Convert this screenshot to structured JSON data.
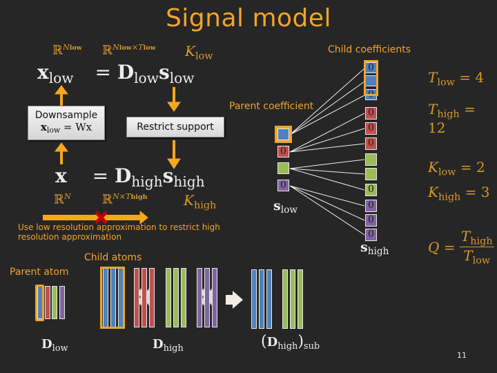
{
  "title": "Signal model",
  "equation_low": {
    "lhs": "x",
    "lhs_sub": "low",
    "eq": "=",
    "dict": "D",
    "dict_sub": "low",
    "coef": "s",
    "coef_sub": "low",
    "dim_x": "ℝ",
    "dim_x_sup": "N",
    "dim_x_sup_sub": "low",
    "dim_d": "ℝ",
    "dim_d_sup": "N",
    "dim_d_sup_sub1": "low",
    "dim_d_sup_times": "×T",
    "dim_d_sup_sub2": "low",
    "sparsity": "K",
    "sparsity_sub": "low"
  },
  "equation_high": {
    "lhs": "x",
    "eq": "=",
    "dict": "D",
    "dict_sub": "high",
    "coef": "s",
    "coef_sub": "high",
    "dim_x": "ℝ",
    "dim_x_sup": "N",
    "dim_d": "ℝ",
    "dim_d_sup": "N×T",
    "dim_d_sup_sub": "high",
    "sparsity": "K",
    "sparsity_sub": "high"
  },
  "downsample_box": {
    "line1": "Downsample",
    "lhs": "x",
    "lhs_sub": "low",
    "rhs": "= Wx"
  },
  "restrict_box": {
    "label": "Restrict support"
  },
  "labels": {
    "child_coefficients": "Child coefficients",
    "parent_coefficient": "Parent coefficient",
    "s_low": "s",
    "s_low_sub": "low",
    "s_high": "s",
    "s_high_sub": "high",
    "note": "Use low resolution approximation to restrict high resolution approximation",
    "child_atoms": "Child atoms",
    "parent_atom": "Parent atom",
    "d_low": "D",
    "d_low_sub": "low",
    "d_high": "D",
    "d_high_sub": "high",
    "d_high_sub_open": "(",
    "d_high_sub_close": ")",
    "d_high_sub_label": "sub"
  },
  "params": {
    "t_low": {
      "sym": "T",
      "sub": "low",
      "val": "= 4"
    },
    "t_high": {
      "sym": "T",
      "sub": "high",
      "val": "= 12"
    },
    "k_low": {
      "sym": "K",
      "sub": "low",
      "val": "= 2"
    },
    "k_high": {
      "sym": "K",
      "sub": "high",
      "val": "= 3"
    },
    "q": {
      "sym": "Q",
      "eq": "=",
      "num": "T",
      "num_sub": "high",
      "den": "T",
      "den_sub": "low"
    }
  },
  "s_low_cells": [
    {
      "color": "blue",
      "value": "",
      "highlight": true
    },
    {
      "color": "red",
      "value": "0",
      "highlight": false
    },
    {
      "color": "green",
      "value": "",
      "highlight": false
    },
    {
      "color": "purple",
      "value": "0",
      "highlight": false
    }
  ],
  "s_high_cells": [
    {
      "color": "blue",
      "value": "0"
    },
    {
      "color": "blue",
      "value": ""
    },
    {
      "color": "blue",
      "value": "0"
    },
    {
      "color": "red",
      "value": "0"
    },
    {
      "color": "red",
      "value": "0"
    },
    {
      "color": "red",
      "value": "0"
    },
    {
      "color": "green",
      "value": ""
    },
    {
      "color": "green",
      "value": ""
    },
    {
      "color": "green",
      "value": "0"
    },
    {
      "color": "purple",
      "value": "0"
    },
    {
      "color": "purple",
      "value": "0"
    },
    {
      "color": "purple",
      "value": "0"
    }
  ],
  "colors": {
    "accent": "#f2a52a",
    "blue": "#4f81bd",
    "red": "#c0504d",
    "green": "#9bbb59",
    "purple": "#8064a2",
    "cross": "#c00000"
  },
  "page_number": "11"
}
